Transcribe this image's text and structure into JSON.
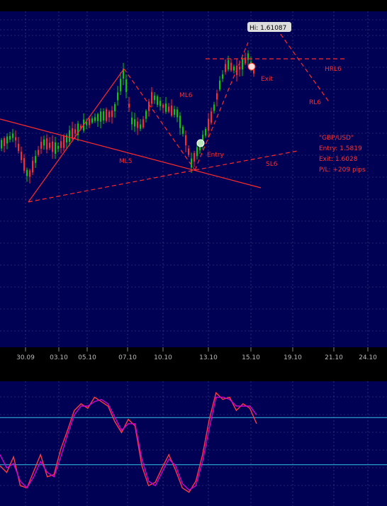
{
  "chart_data": [
    {
      "type": "candlestick",
      "symbol": "\"GBP/USD\"",
      "x_tick_labels": [
        "30.09",
        "03.10",
        "05.10",
        "07.10",
        "10.10",
        "13.10",
        "15.10",
        "19.10",
        "21.10",
        "24.10"
      ],
      "high_label": "Hi: 1.61087",
      "series": [
        {
          "kind": "ohlc",
          "values": []
        }
      ],
      "annotations": {
        "lines": [
          "ML6",
          "ML5",
          "SL6",
          "HRL6",
          "RL6"
        ],
        "markers": [
          "Entry",
          "Exit"
        ]
      },
      "trade_box": {
        "symbol": "\"GBP/USD\"",
        "entry": "Entry: 1.5819",
        "exit": "Exit: 1.6028",
        "pl": "P/L: +209 pips"
      },
      "colors": {
        "background": "#000055",
        "up_candle": "#00cc00",
        "down_candle": "#ff2a2a",
        "annotation": "#ff2a2a",
        "grid": "#4a4a80"
      }
    },
    {
      "type": "line",
      "series": [
        {
          "values": [
            0.3,
            0.24,
            0.38,
            0.12,
            0.1,
            0.25,
            0.4,
            0.2,
            0.22,
            0.45,
            0.62,
            0.8,
            0.86,
            0.82,
            0.92,
            0.88,
            0.84,
            0.7,
            0.6,
            0.72,
            0.66,
            0.3,
            0.12,
            0.15,
            0.28,
            0.4,
            0.26,
            0.1,
            0.06,
            0.16,
            0.4,
            0.72,
            0.96,
            0.9,
            0.92,
            0.8,
            0.86,
            0.82,
            0.68
          ],
          "color": "#ff3b3b"
        },
        {
          "values": [
            0.4,
            0.28,
            0.32,
            0.16,
            0.1,
            0.2,
            0.34,
            0.24,
            0.2,
            0.38,
            0.58,
            0.76,
            0.84,
            0.84,
            0.88,
            0.9,
            0.86,
            0.74,
            0.62,
            0.68,
            0.68,
            0.36,
            0.16,
            0.12,
            0.24,
            0.36,
            0.3,
            0.14,
            0.08,
            0.12,
            0.34,
            0.64,
            0.92,
            0.92,
            0.9,
            0.84,
            0.84,
            0.84,
            0.76
          ],
          "color": "#cc00cc"
        }
      ],
      "levels": [
        80,
        20
      ],
      "colors": {
        "background": "#000055",
        "level_line": "#33c6e6"
      }
    }
  ]
}
